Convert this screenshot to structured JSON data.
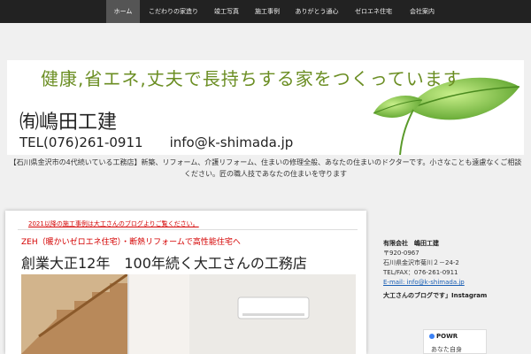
{
  "nav": {
    "items": [
      {
        "label": "ホーム",
        "active": true
      },
      {
        "label": "こだわりの家造り"
      },
      {
        "label": "竣工写真"
      },
      {
        "label": "施工事例"
      },
      {
        "label": "ありがとう通心"
      },
      {
        "label": "ゼロエネ住宅"
      },
      {
        "label": "会社案内"
      }
    ]
  },
  "banner": {
    "tagline": "健康,省エネ,丈夫で長持ちする家をつくっています",
    "company": "㈲嶋田工建",
    "tel": "TEL(076)261-0911",
    "email": "info@k-shimada.jp"
  },
  "intro": {
    "text": "【石川県金沢市の4代続いている工務店】新築、リフォーム、介護リフォーム、住まいの修理全般、あなたの住まいのドクターです。小さなことも遠慮なくご相談ください。匠の職人技であなたの住まいを守ります"
  },
  "main": {
    "notice": "2021以降の施工事例は大工さんのブログよりご覧ください。",
    "zeh": "ZEH（暖かいゼロエネ住宅）・断熱リフォームで高性能住宅へ",
    "headline": "創業大正12年　100年続く大工さんの工務店"
  },
  "sidebar": {
    "company_name": "有限会社　嶋田工建",
    "postal": "〒920-0967",
    "address": "石川県金沢市菊川２－24-2",
    "telfax": "TEL/FAX：076-261-0911",
    "email_link": "E-mail: info@k-shimada.jp",
    "blog": "大工さんのブログです」Instagram"
  },
  "powr": {
    "logo": "POWR",
    "sub": "あなた自身"
  },
  "colors": {
    "nav_bg": "#222222",
    "accent_red": "#d40000",
    "tagline_green": "#6b8e23",
    "link_blue": "#1a5fb4"
  }
}
